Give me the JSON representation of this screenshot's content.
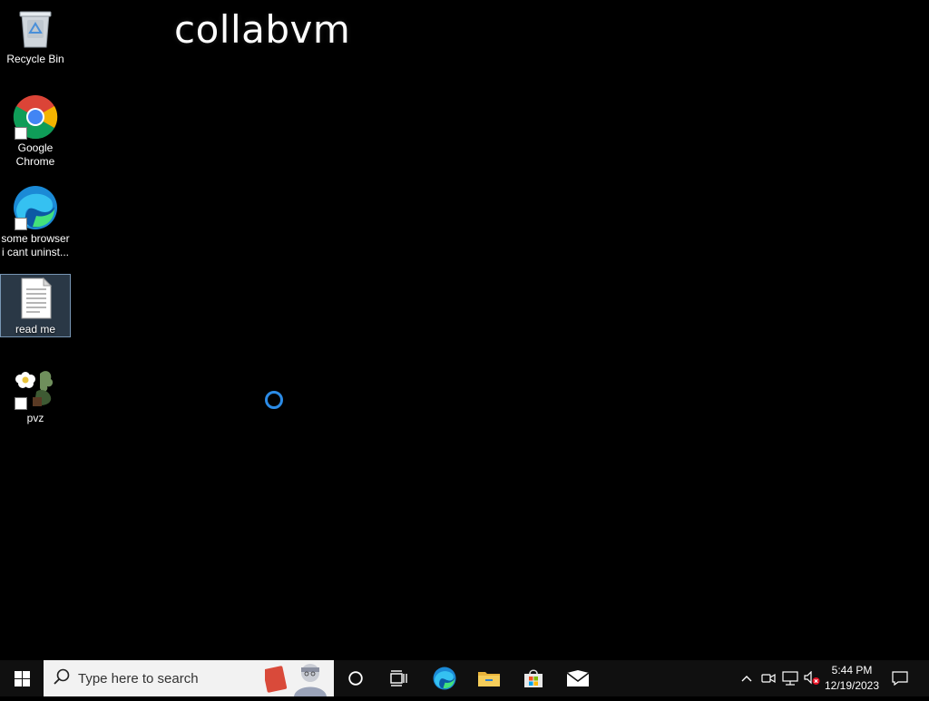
{
  "desktop": {
    "watermark": "collabvm",
    "icons": [
      {
        "label": "Recycle Bin"
      },
      {
        "label": "Google Chrome"
      },
      {
        "label": "some browser i cant uninst..."
      },
      {
        "label": "read me"
      },
      {
        "label": "pvz"
      }
    ]
  },
  "taskbar": {
    "search": {
      "placeholder": "Type here to search"
    },
    "apps": [
      "cortana-icon",
      "task-view-icon",
      "edge-icon",
      "file-explorer-icon",
      "store-icon",
      "mail-icon"
    ],
    "tray": {
      "time": "5:44 PM",
      "date": "12/19/2023"
    }
  },
  "colors": {
    "desktop_bg": "#000000",
    "taskbar_bg": "#101010",
    "selection": "#78a0c8",
    "spinner": "#2b8be6"
  }
}
